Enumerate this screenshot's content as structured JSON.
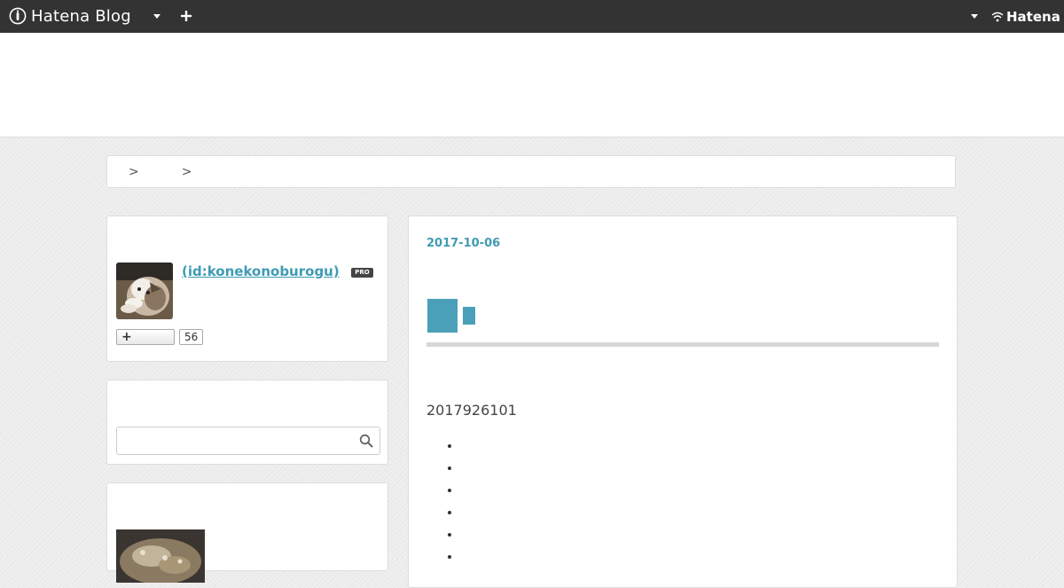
{
  "globalheader": {
    "logo_text": "Hatena Blog",
    "hatena_text": "Hatena",
    "colors": {
      "background": "#333333",
      "text": "#ffffff"
    }
  },
  "breadcrumb": {
    "home_label": "",
    "category_label": "",
    "separator": ">"
  },
  "profile": {
    "id_label": " (id:konekonoburogu)",
    "pro_label": "PRO",
    "reader_count": "56"
  },
  "search": {
    "placeholder": ""
  },
  "entry": {
    "date": "2017-10-06",
    "body_text": "2017926101",
    "list_items": [
      "",
      "",
      "",
      "",
      "",
      ""
    ]
  },
  "colors": {
    "accent": "#3e9bb3",
    "title_block": "#4aa0b8"
  }
}
